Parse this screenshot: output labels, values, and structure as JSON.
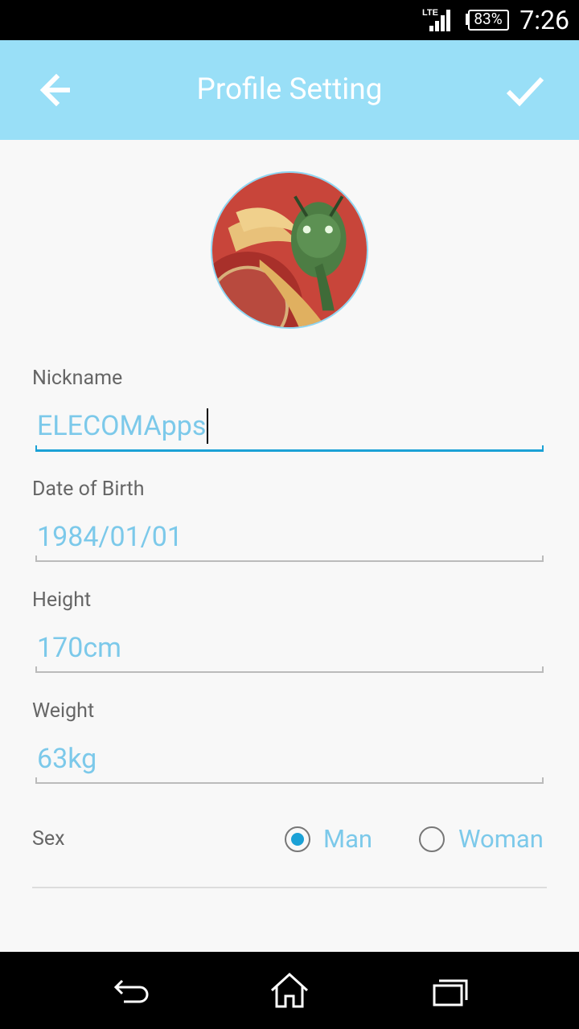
{
  "status_bar": {
    "network": "LTE",
    "battery": "83%",
    "time": "7:26",
    "icons": [
      "lte-signal-icon",
      "battery-icon"
    ]
  },
  "app_bar": {
    "title": "Profile Setting",
    "back_icon": "arrow-back-icon",
    "confirm_icon": "checkmark-icon",
    "background": "#99dff7"
  },
  "profile": {
    "avatar_icon": "avatar-image"
  },
  "form": {
    "nickname": {
      "label": "Nickname",
      "value": "ELECOMApps"
    },
    "dob": {
      "label": "Date of Birth",
      "value": "1984/01/01"
    },
    "height": {
      "label": "Height",
      "value": "170cm"
    },
    "weight": {
      "label": "Weight",
      "value": "63kg"
    },
    "sex": {
      "label": "Sex",
      "options": [
        "Man",
        "Woman"
      ],
      "selected": "Man"
    }
  },
  "colors": {
    "accent": "#1ba1d6",
    "value_text": "#7cc9ea",
    "label_text": "#666666"
  },
  "nav_bar": {
    "icons": [
      "nav-back-icon",
      "nav-home-icon",
      "nav-recents-icon"
    ]
  }
}
